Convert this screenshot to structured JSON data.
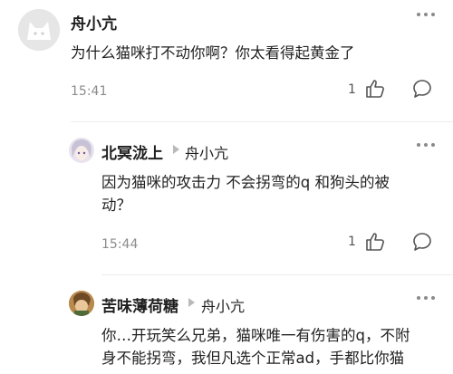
{
  "comments": [
    {
      "author": "舟小亢",
      "text": "为什么猫咪打不动你啊？你太看得起黄金了",
      "time": "15:41",
      "likes": "1"
    },
    {
      "author": "北冥泷上",
      "reply_to": "舟小亢",
      "text_line1": "因为猫咪的攻击力 不会拐弯的q 和狗头的被",
      "text_line2": "动？",
      "time": "15:44",
      "likes": "1"
    },
    {
      "author": "苦味薄荷糖",
      "reply_to": "舟小亢",
      "text_line1": "你…开玩笑么兄弟，猫咪唯一有伤害的q，不附",
      "text_line2": "身不能拐弯，我但凡选个正常ad，手都比你猫"
    }
  ],
  "icons": {
    "more": "more-dots-icon",
    "like": "thumbs-up-icon",
    "comment": "comment-bubble-icon",
    "reply_arrow": "reply-arrow-icon"
  }
}
